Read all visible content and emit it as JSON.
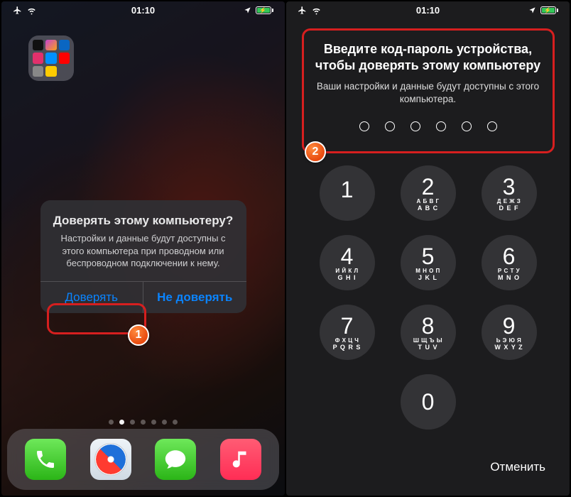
{
  "status": {
    "time": "01:10"
  },
  "left": {
    "alert": {
      "title": "Доверять этому компьютеру?",
      "message": "Настройки и данные будут доступны с этого компьютера при проводном или беспроводном подключении к нему.",
      "trust": "Доверять",
      "dont_trust": "Не доверять"
    },
    "badge": "1"
  },
  "right": {
    "title": "Введите код-пароль устройства, чтобы доверять этому компьютеру",
    "subtitle": "Ваши настройки и данные будут доступны с этого компьютера.",
    "keys": [
      {
        "num": "1",
        "ru": "",
        "en": ""
      },
      {
        "num": "2",
        "ru": "А Б В Г",
        "en": "A B C"
      },
      {
        "num": "3",
        "ru": "Д Е Ж З",
        "en": "D E F"
      },
      {
        "num": "4",
        "ru": "И Й К Л",
        "en": "G H I"
      },
      {
        "num": "5",
        "ru": "М Н О П",
        "en": "J K L"
      },
      {
        "num": "6",
        "ru": "Р С Т У",
        "en": "M N O"
      },
      {
        "num": "7",
        "ru": "Ф Х Ц Ч",
        "en": "P Q R S"
      },
      {
        "num": "8",
        "ru": "Ш Щ Ъ Ы",
        "en": "T U V"
      },
      {
        "num": "9",
        "ru": "Ь Э Ю Я",
        "en": "W X Y Z"
      },
      {
        "num": "0",
        "ru": "",
        "en": ""
      }
    ],
    "cancel": "Отменить",
    "badge": "2"
  }
}
